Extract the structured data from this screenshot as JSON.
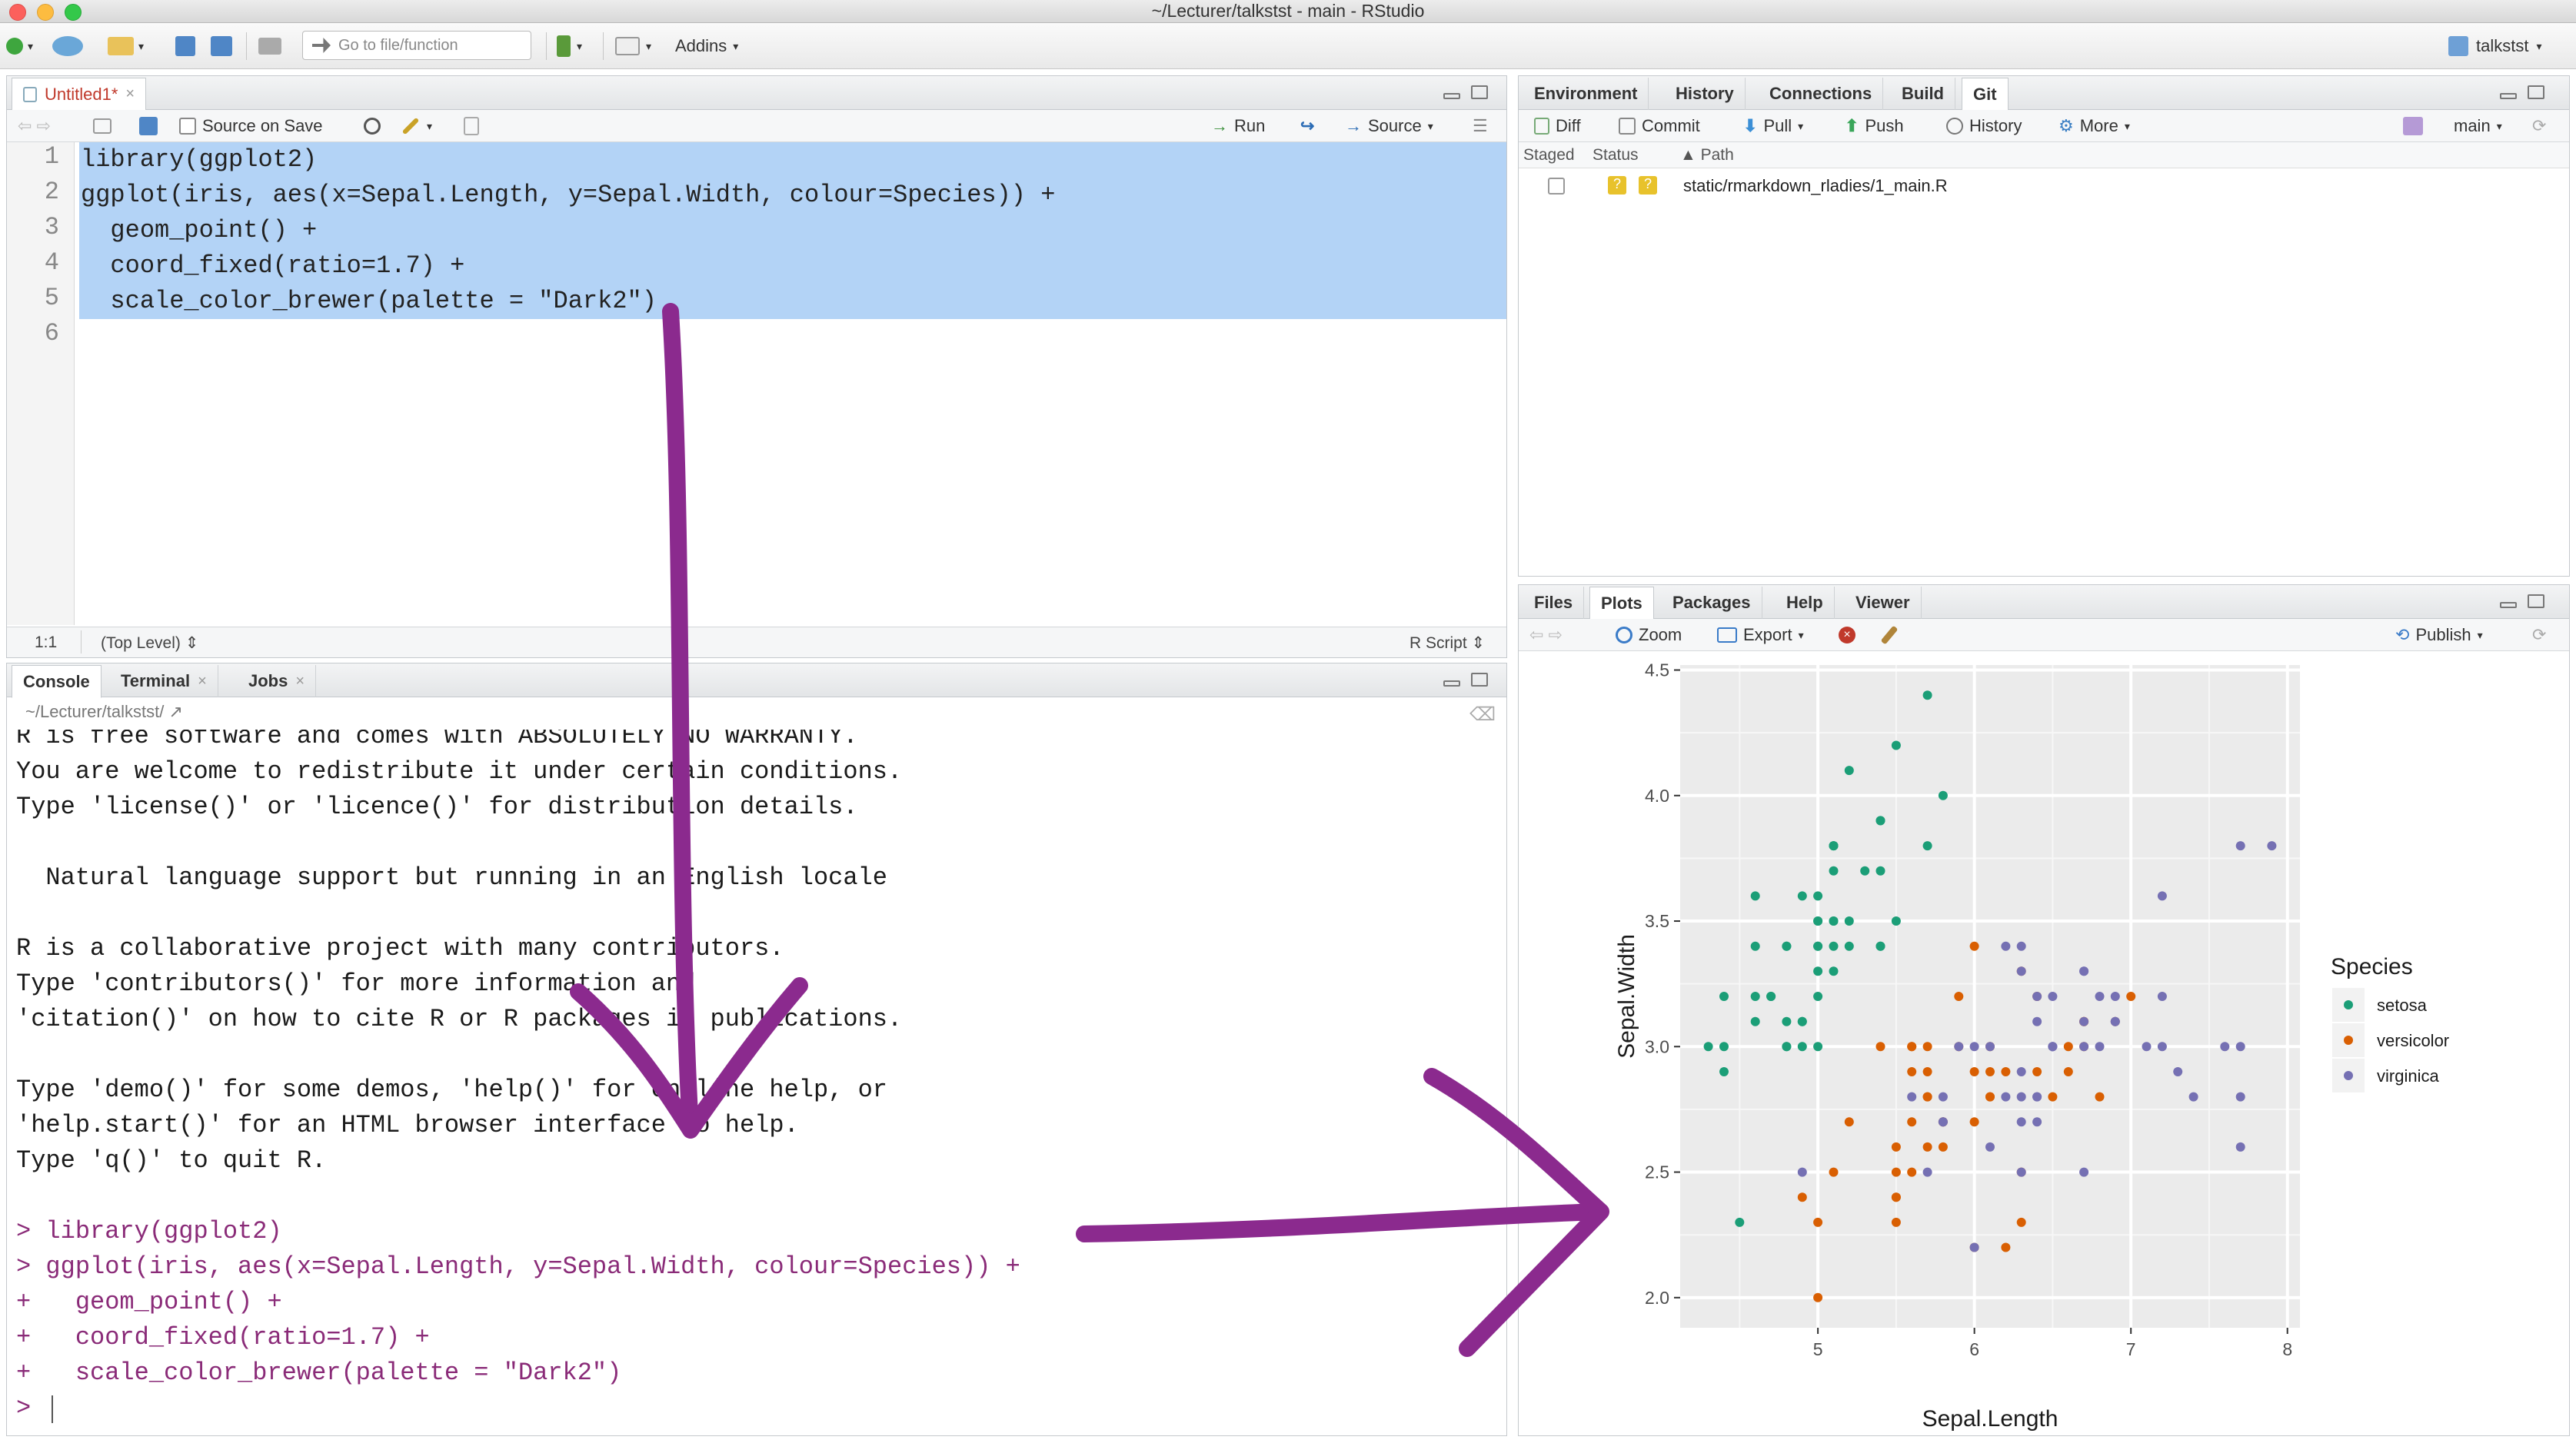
{
  "window": {
    "title": "~/Lecturer/talkstst - main - RStudio"
  },
  "toolbar": {
    "goto_placeholder": "Go to file/function",
    "addins": "Addins",
    "project": "talkstst"
  },
  "editor": {
    "tab": "Untitled1*",
    "source_on_save": "Source on Save",
    "run": "Run",
    "source": "Source",
    "lines": [
      {
        "n": "1",
        "text": "library(ggplot2)"
      },
      {
        "n": "2",
        "text": "ggplot(iris, aes(x=Sepal.Length, y=Sepal.Width, colour=Species)) +"
      },
      {
        "n": "3",
        "text": "  geom_point() +"
      },
      {
        "n": "4",
        "text": "  coord_fixed(ratio=1.7) +"
      },
      {
        "n": "5",
        "text": "  scale_color_brewer(palette = \"Dark2\")"
      },
      {
        "n": "6",
        "text": ""
      }
    ],
    "status_pos": "1:1",
    "status_scope": "(Top Level)",
    "status_lang": "R Script"
  },
  "console": {
    "tabs": [
      "Console",
      "Terminal",
      "Jobs"
    ],
    "path": "~/Lecturer/talkstst/",
    "lines": [
      "R is free software and comes with ABSOLUTELY NO WARRANTY.",
      "You are welcome to redistribute it under certain conditions.",
      "Type 'license()' or 'licence()' for distribution details.",
      "",
      "  Natural language support but running in an English locale",
      "",
      "R is a collaborative project with many contributors.",
      "Type 'contributors()' for more information and",
      "'citation()' on how to cite R or R packages in publications.",
      "",
      "Type 'demo()' for some demos, 'help()' for on-line help, or",
      "'help.start()' for an HTML browser interface to help.",
      "Type 'q()' to quit R.",
      ""
    ],
    "commands": [
      "> library(ggplot2)",
      "> ggplot(iris, aes(x=Sepal.Length, y=Sepal.Width, colour=Species)) +",
      "+   geom_point() +",
      "+   coord_fixed(ratio=1.7) +",
      "+   scale_color_brewer(palette = \"Dark2\")",
      "> "
    ]
  },
  "env_pane": {
    "tabs": [
      "Environment",
      "History",
      "Connections",
      "Build",
      "Git"
    ],
    "buttons": {
      "diff": "Diff",
      "commit": "Commit",
      "pull": "Pull",
      "push": "Push",
      "history": "History",
      "more": "More",
      "branch": "main"
    },
    "headers": {
      "staged": "Staged",
      "status": "Status",
      "path": "Path"
    },
    "file": "static/rmarkdown_rladies/1_main.R"
  },
  "files_pane": {
    "tabs": [
      "Files",
      "Plots",
      "Packages",
      "Help",
      "Viewer"
    ],
    "zoom": "Zoom",
    "export": "Export",
    "publish": "Publish"
  },
  "colors": {
    "setosa": "#1b9e77",
    "versicolor": "#d95f02",
    "virginica": "#7570b3",
    "annotation": "#8b2a8e"
  },
  "chart_data": {
    "type": "scatter",
    "xlabel": "Sepal.Length",
    "ylabel": "Sepal.Width",
    "xlim": [
      4.3,
      7.9
    ],
    "ylim": [
      2.0,
      4.4
    ],
    "x_ticks": [
      "5",
      "6",
      "7",
      "8"
    ],
    "y_ticks": [
      "2.0",
      "2.5",
      "3.0",
      "3.5",
      "4.0",
      "4.5"
    ],
    "legend_title": "Species",
    "legend_position": "right",
    "series": [
      {
        "name": "setosa",
        "color": "#1b9e77",
        "points": [
          [
            5.1,
            3.5
          ],
          [
            4.9,
            3.0
          ],
          [
            4.7,
            3.2
          ],
          [
            4.6,
            3.1
          ],
          [
            5.0,
            3.6
          ],
          [
            5.4,
            3.9
          ],
          [
            4.6,
            3.4
          ],
          [
            5.0,
            3.4
          ],
          [
            4.4,
            2.9
          ],
          [
            4.9,
            3.1
          ],
          [
            5.4,
            3.7
          ],
          [
            4.8,
            3.4
          ],
          [
            4.8,
            3.0
          ],
          [
            4.3,
            3.0
          ],
          [
            5.8,
            4.0
          ],
          [
            5.7,
            4.4
          ],
          [
            5.4,
            3.9
          ],
          [
            5.1,
            3.5
          ],
          [
            5.7,
            3.8
          ],
          [
            5.1,
            3.8
          ],
          [
            5.4,
            3.4
          ],
          [
            5.1,
            3.7
          ],
          [
            4.6,
            3.6
          ],
          [
            5.1,
            3.3
          ],
          [
            4.8,
            3.4
          ],
          [
            5.0,
            3.0
          ],
          [
            5.0,
            3.4
          ],
          [
            5.2,
            3.5
          ],
          [
            5.2,
            3.4
          ],
          [
            4.7,
            3.2
          ],
          [
            4.8,
            3.1
          ],
          [
            5.4,
            3.4
          ],
          [
            5.2,
            4.1
          ],
          [
            5.5,
            4.2
          ],
          [
            4.9,
            3.1
          ],
          [
            5.0,
            3.2
          ],
          [
            5.5,
            3.5
          ],
          [
            4.9,
            3.6
          ],
          [
            4.4,
            3.0
          ],
          [
            5.1,
            3.4
          ],
          [
            5.0,
            3.5
          ],
          [
            4.5,
            2.3
          ],
          [
            4.4,
            3.2
          ],
          [
            5.0,
            3.5
          ],
          [
            5.1,
            3.8
          ],
          [
            4.8,
            3.0
          ],
          [
            5.1,
            3.8
          ],
          [
            4.6,
            3.2
          ],
          [
            5.3,
            3.7
          ],
          [
            5.0,
            3.3
          ]
        ]
      },
      {
        "name": "versicolor",
        "color": "#d95f02",
        "points": [
          [
            7.0,
            3.2
          ],
          [
            6.4,
            3.2
          ],
          [
            6.9,
            3.1
          ],
          [
            5.5,
            2.3
          ],
          [
            6.5,
            2.8
          ],
          [
            5.7,
            2.8
          ],
          [
            6.3,
            3.3
          ],
          [
            4.9,
            2.4
          ],
          [
            6.6,
            2.9
          ],
          [
            5.2,
            2.7
          ],
          [
            5.0,
            2.0
          ],
          [
            5.9,
            3.0
          ],
          [
            6.0,
            2.2
          ],
          [
            6.1,
            2.9
          ],
          [
            5.6,
            2.9
          ],
          [
            6.7,
            3.1
          ],
          [
            5.6,
            3.0
          ],
          [
            5.8,
            2.7
          ],
          [
            6.2,
            2.2
          ],
          [
            5.6,
            2.5
          ],
          [
            5.9,
            3.2
          ],
          [
            6.1,
            2.8
          ],
          [
            6.3,
            2.5
          ],
          [
            6.1,
            2.8
          ],
          [
            6.4,
            2.9
          ],
          [
            6.6,
            3.0
          ],
          [
            6.8,
            2.8
          ],
          [
            6.7,
            3.0
          ],
          [
            6.0,
            2.9
          ],
          [
            5.7,
            2.6
          ],
          [
            5.5,
            2.4
          ],
          [
            5.5,
            2.4
          ],
          [
            5.8,
            2.7
          ],
          [
            6.0,
            2.7
          ],
          [
            5.4,
            3.0
          ],
          [
            6.0,
            3.4
          ],
          [
            6.7,
            3.1
          ],
          [
            6.3,
            2.3
          ],
          [
            5.6,
            3.0
          ],
          [
            5.5,
            2.5
          ],
          [
            5.5,
            2.6
          ],
          [
            6.1,
            3.0
          ],
          [
            5.8,
            2.6
          ],
          [
            5.0,
            2.3
          ],
          [
            5.6,
            2.7
          ],
          [
            5.7,
            3.0
          ],
          [
            5.7,
            2.9
          ],
          [
            6.2,
            2.9
          ],
          [
            5.1,
            2.5
          ],
          [
            5.7,
            2.8
          ]
        ]
      },
      {
        "name": "virginica",
        "color": "#7570b3",
        "points": [
          [
            6.3,
            3.3
          ],
          [
            5.8,
            2.7
          ],
          [
            7.1,
            3.0
          ],
          [
            6.3,
            2.9
          ],
          [
            6.5,
            3.0
          ],
          [
            7.6,
            3.0
          ],
          [
            4.9,
            2.5
          ],
          [
            7.3,
            2.9
          ],
          [
            6.7,
            2.5
          ],
          [
            7.2,
            3.6
          ],
          [
            6.5,
            3.2
          ],
          [
            6.4,
            2.7
          ],
          [
            6.8,
            3.0
          ],
          [
            5.7,
            2.5
          ],
          [
            5.8,
            2.8
          ],
          [
            6.4,
            3.2
          ],
          [
            6.5,
            3.0
          ],
          [
            7.7,
            3.8
          ],
          [
            7.7,
            2.6
          ],
          [
            6.0,
            2.2
          ],
          [
            6.9,
            3.2
          ],
          [
            5.6,
            2.8
          ],
          [
            7.7,
            2.8
          ],
          [
            6.3,
            2.7
          ],
          [
            6.7,
            3.3
          ],
          [
            7.2,
            3.2
          ],
          [
            6.2,
            2.8
          ],
          [
            6.1,
            3.0
          ],
          [
            6.4,
            2.8
          ],
          [
            7.2,
            3.0
          ],
          [
            7.4,
            2.8
          ],
          [
            7.9,
            3.8
          ],
          [
            6.4,
            2.8
          ],
          [
            6.3,
            2.8
          ],
          [
            6.1,
            2.6
          ],
          [
            7.7,
            3.0
          ],
          [
            6.3,
            3.4
          ],
          [
            6.4,
            3.1
          ],
          [
            6.0,
            3.0
          ],
          [
            6.9,
            3.1
          ],
          [
            6.7,
            3.1
          ],
          [
            6.9,
            3.1
          ],
          [
            5.8,
            2.7
          ],
          [
            6.8,
            3.2
          ],
          [
            6.7,
            3.3
          ],
          [
            6.7,
            3.0
          ],
          [
            6.3,
            2.5
          ],
          [
            6.5,
            3.0
          ],
          [
            6.2,
            3.4
          ],
          [
            5.9,
            3.0
          ]
        ]
      }
    ]
  }
}
